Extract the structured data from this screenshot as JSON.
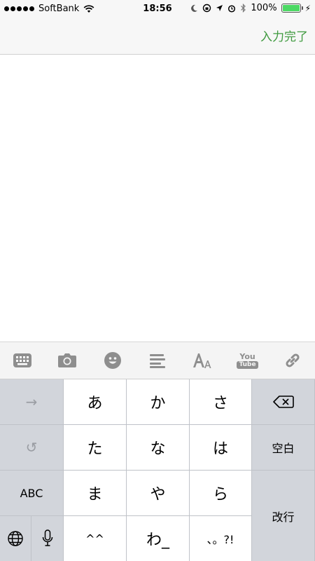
{
  "status_bar": {
    "carrier": "SoftBank",
    "time": "18:56",
    "battery": "100%",
    "battery_level": 1.0
  },
  "nav": {
    "done_label": "入力完了"
  },
  "toolbar": {
    "icons": [
      "keyboard-icon",
      "camera-icon",
      "emoji-icon",
      "align-icon",
      "font-size-icon",
      "youtube-icon",
      "link-icon"
    ],
    "youtube_top": "You",
    "youtube_bottom": "Tube"
  },
  "keyboard": {
    "next_arrow": "→",
    "undo": "↺",
    "abc": "ABC",
    "globe": "globe-icon",
    "mic": "mic-icon",
    "row1": [
      "あ",
      "か",
      "さ"
    ],
    "row2": [
      "た",
      "な",
      "は"
    ],
    "row3": [
      "ま",
      "や",
      "ら"
    ],
    "row4": [
      "^^",
      "わ_",
      "、。?!"
    ],
    "space": "空白",
    "return": "改行",
    "delete": "delete-icon"
  }
}
